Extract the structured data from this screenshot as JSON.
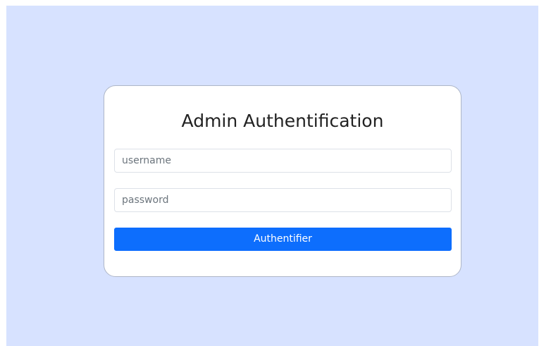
{
  "login": {
    "title": "Admin Authentification",
    "username_placeholder": "username",
    "password_placeholder": "password",
    "submit_label": "Authentifier"
  },
  "colors": {
    "background": "#d7e2ff",
    "card": "#ffffff",
    "accent": "#0d6efd",
    "title_text": "#222222"
  }
}
